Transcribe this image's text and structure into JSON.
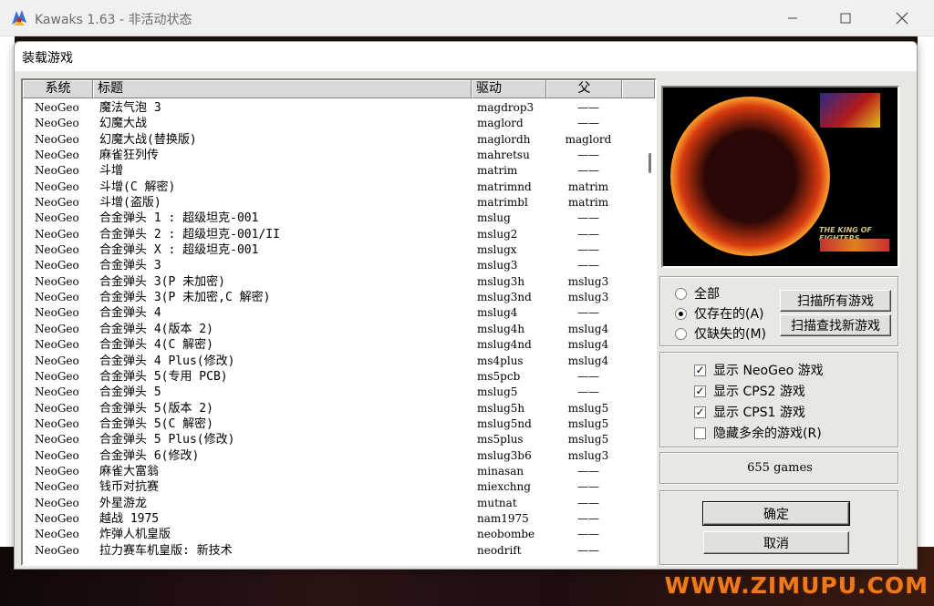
{
  "window": {
    "title": "Kawaks 1.63 - 非活动状态",
    "watermark": "WWW.ZIMUPU.COM"
  },
  "dialog": {
    "title": "装载游戏",
    "columns": {
      "system": "系统",
      "title": "标题",
      "driver": "驱动",
      "parent": "父"
    },
    "rows": [
      {
        "system": "NeoGeo",
        "title": "魔法气泡 3",
        "driver": "magdrop3",
        "parent": "——"
      },
      {
        "system": "NeoGeo",
        "title": "幻魔大战",
        "driver": "maglord",
        "parent": "——"
      },
      {
        "system": "NeoGeo",
        "title": "幻魔大战(替换版)",
        "driver": "maglordh",
        "parent": "maglord"
      },
      {
        "system": "NeoGeo",
        "title": "麻雀狂列传",
        "driver": "mahretsu",
        "parent": "——"
      },
      {
        "system": "NeoGeo",
        "title": "斗增",
        "driver": "matrim",
        "parent": "——"
      },
      {
        "system": "NeoGeo",
        "title": "斗增(C 解密)",
        "driver": "matrimnd",
        "parent": "matrim"
      },
      {
        "system": "NeoGeo",
        "title": "斗增(盗版)",
        "driver": "matrimbl",
        "parent": "matrim"
      },
      {
        "system": "NeoGeo",
        "title": "合金弹头 1 : 超级坦克-001",
        "driver": "mslug",
        "parent": "——"
      },
      {
        "system": "NeoGeo",
        "title": "合金弹头 2 : 超级坦克-001/II",
        "driver": "mslug2",
        "parent": "——"
      },
      {
        "system": "NeoGeo",
        "title": "合金弹头 X : 超级坦克-001",
        "driver": "mslugx",
        "parent": "——"
      },
      {
        "system": "NeoGeo",
        "title": "合金弹头 3",
        "driver": "mslug3",
        "parent": "——"
      },
      {
        "system": "NeoGeo",
        "title": "合金弹头 3(P 未加密)",
        "driver": "mslug3h",
        "parent": "mslug3"
      },
      {
        "system": "NeoGeo",
        "title": "合金弹头 3(P 未加密,C 解密)",
        "driver": "mslug3nd",
        "parent": "mslug3"
      },
      {
        "system": "NeoGeo",
        "title": "合金弹头 4",
        "driver": "mslug4",
        "parent": "——"
      },
      {
        "system": "NeoGeo",
        "title": "合金弹头 4(版本 2)",
        "driver": "mslug4h",
        "parent": "mslug4"
      },
      {
        "system": "NeoGeo",
        "title": "合金弹头 4(C 解密)",
        "driver": "mslug4nd",
        "parent": "mslug4"
      },
      {
        "system": "NeoGeo",
        "title": "合金弹头 4 Plus(修改)",
        "driver": "ms4plus",
        "parent": "mslug4"
      },
      {
        "system": "NeoGeo",
        "title": "合金弹头 5(专用 PCB)",
        "driver": "ms5pcb",
        "parent": "——"
      },
      {
        "system": "NeoGeo",
        "title": "合金弹头 5",
        "driver": "mslug5",
        "parent": "——"
      },
      {
        "system": "NeoGeo",
        "title": "合金弹头 5(版本 2)",
        "driver": "mslug5h",
        "parent": "mslug5"
      },
      {
        "system": "NeoGeo",
        "title": "合金弹头 5(C 解密)",
        "driver": "mslug5nd",
        "parent": "mslug5"
      },
      {
        "system": "NeoGeo",
        "title": "合金弹头 5 Plus(修改)",
        "driver": "ms5plus",
        "parent": "mslug5"
      },
      {
        "system": "NeoGeo",
        "title": "合金弹头 6(修改)",
        "driver": "mslug3b6",
        "parent": "mslug3"
      },
      {
        "system": "NeoGeo",
        "title": "麻雀大富翁",
        "driver": "minasan",
        "parent": "——"
      },
      {
        "system": "NeoGeo",
        "title": "钱币对抗赛",
        "driver": "miexchng",
        "parent": "——"
      },
      {
        "system": "NeoGeo",
        "title": "外星游龙",
        "driver": "mutnat",
        "parent": "——"
      },
      {
        "system": "NeoGeo",
        "title": "越战 1975",
        "driver": "nam1975",
        "parent": "——"
      },
      {
        "system": "NeoGeo",
        "title": "炸弹人机皇版",
        "driver": "neobombe",
        "parent": "——"
      },
      {
        "system": "NeoGeo",
        "title": "拉力赛车机皇版: 新技术",
        "driver": "neodrift",
        "parent": "——"
      }
    ]
  },
  "filter": {
    "options": [
      "全部",
      "仅存在的(A)",
      "仅缺失的(M)"
    ],
    "selected_index": 1,
    "scan_all_button": "扫描所有游戏",
    "scan_new_button": "扫描查找新游戏"
  },
  "display": {
    "options": [
      {
        "label": "显示 NeoGeo 游戏",
        "checked": true
      },
      {
        "label": "显示 CPS2 游戏",
        "checked": true
      },
      {
        "label": "显示 CPS1 游戏",
        "checked": true
      },
      {
        "label": "隐藏多余的游戏(R)",
        "checked": false
      }
    ]
  },
  "status": {
    "game_count": "655 games"
  },
  "actions": {
    "ok": "确定",
    "cancel": "取消"
  },
  "preview": {
    "caption": "THE KING OF FIGHTERS"
  }
}
